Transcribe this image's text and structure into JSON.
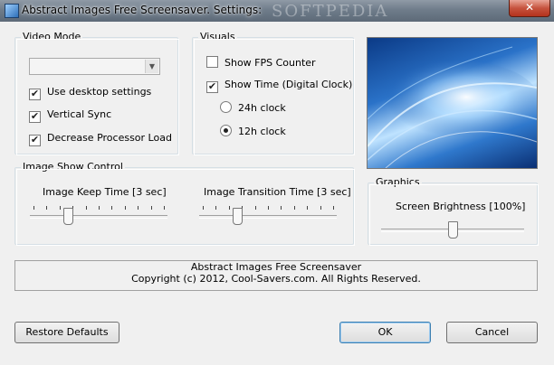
{
  "window": {
    "title": "Abstract Images Free Screensaver. Settings:",
    "watermark": "SOFTPEDIA",
    "close_glyph": "✕"
  },
  "video_mode": {
    "legend": "Video Mode",
    "select_value": "",
    "use_desktop_settings": {
      "label": "Use desktop settings",
      "checked": true
    },
    "vertical_sync": {
      "label": "Vertical Sync",
      "checked": true
    },
    "decrease_processor_load": {
      "label": "Decrease Processor Load",
      "checked": true
    }
  },
  "visuals": {
    "legend": "Visuals",
    "show_fps": {
      "label": "Show FPS Counter",
      "checked": false
    },
    "show_time": {
      "label": "Show Time (Digital Clock)",
      "checked": true
    },
    "clock_24h": {
      "label": "24h clock",
      "selected": false
    },
    "clock_12h": {
      "label": "12h clock",
      "selected": true
    }
  },
  "image_show_control": {
    "legend": "Image Show Control",
    "keep_time": {
      "label": "Image Keep Time [3 sec]",
      "fraction": 0.26
    },
    "transition_time": {
      "label": "Image Transition Time [3 sec]",
      "fraction": 0.26
    }
  },
  "graphics": {
    "legend": "Graphics",
    "brightness": {
      "label": "Screen Brightness [100%]",
      "fraction": 0.5
    }
  },
  "about": {
    "line1": "Abstract Images Free Screensaver",
    "line2": "Copyright (c) 2012, Cool-Savers.com. All Rights Reserved."
  },
  "buttons": {
    "restore_defaults": "Restore Defaults",
    "ok": "OK",
    "cancel": "Cancel"
  },
  "icons": {
    "app": "app-icon",
    "checkmark": "✔",
    "dropdown": "▼"
  }
}
